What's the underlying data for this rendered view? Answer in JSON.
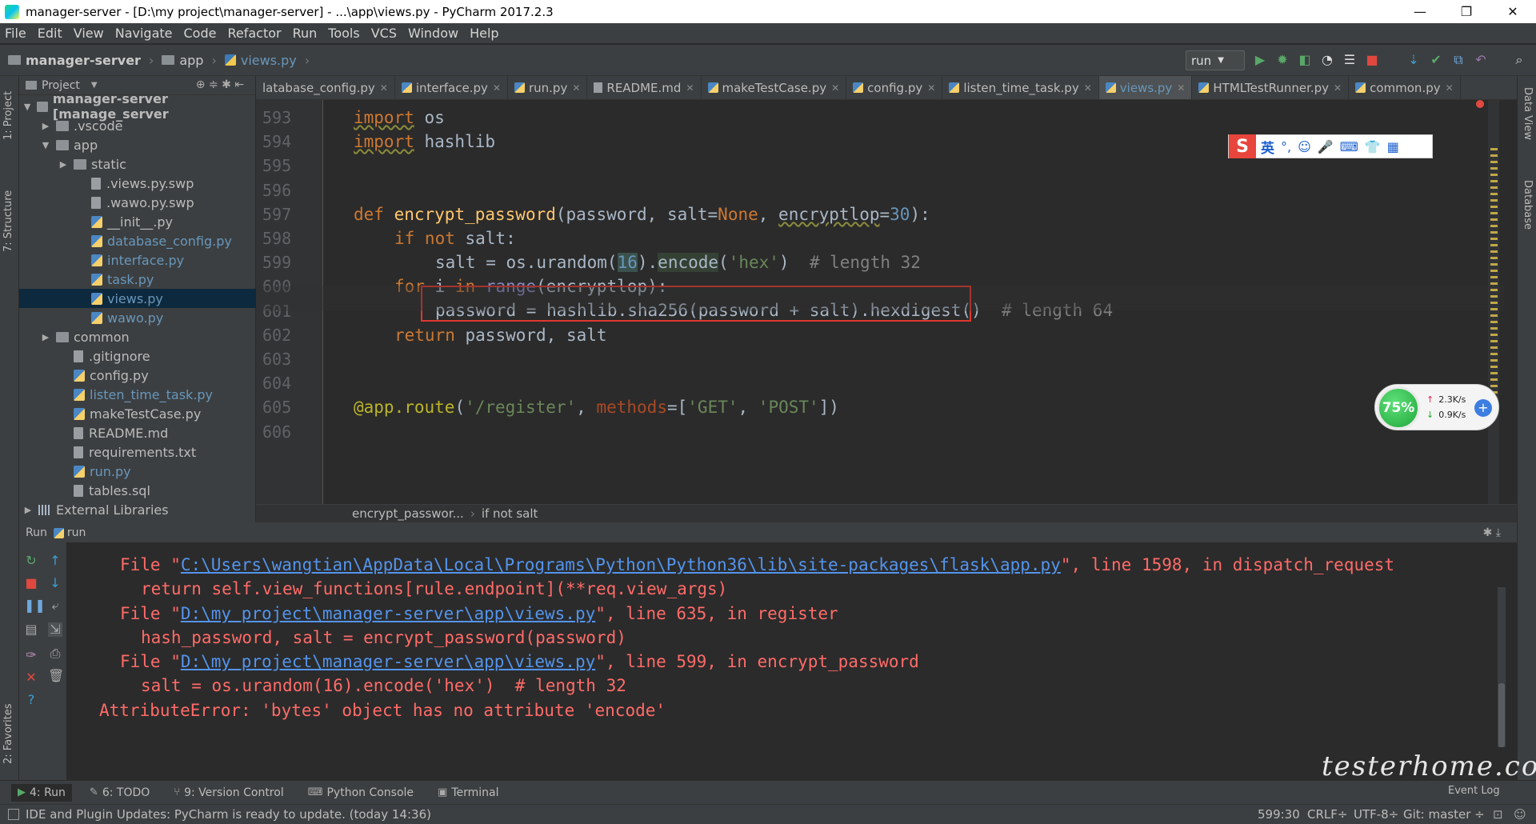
{
  "window": {
    "title": "manager-server - [D:\\my project\\manager-server] - ...\\app\\views.py - PyCharm 2017.2.3",
    "buttons": [
      "—",
      "❐",
      "✕"
    ]
  },
  "menu": [
    "File",
    "Edit",
    "View",
    "Navigate",
    "Code",
    "Refactor",
    "Run",
    "Tools",
    "VCS",
    "Window",
    "Help"
  ],
  "nav": {
    "crumbs": [
      "manager-server",
      "app",
      "views.py"
    ],
    "run_config": "run"
  },
  "left_stripe": {
    "project_label": "1: Project",
    "structure_label": "7: Structure",
    "favorites_label": "2: Favorites"
  },
  "right_stripe": {
    "dataview_label": "Data View",
    "database_label": "Database"
  },
  "project_panel": {
    "header": "Project",
    "items": [
      {
        "label": "manager-server [manage_server",
        "indent": 0,
        "toggle": "▼",
        "kind": "folder",
        "bold": true
      },
      {
        "label": ".vscode",
        "indent": 1,
        "toggle": "▶",
        "kind": "folder"
      },
      {
        "label": "app",
        "indent": 1,
        "toggle": "▼",
        "kind": "folder"
      },
      {
        "label": "static",
        "indent": 2,
        "toggle": "▶",
        "kind": "folder"
      },
      {
        "label": ".views.py.swp",
        "indent": 3,
        "toggle": "",
        "kind": "file"
      },
      {
        "label": ".wawo.py.swp",
        "indent": 3,
        "toggle": "",
        "kind": "file"
      },
      {
        "label": "__init__.py",
        "indent": 3,
        "toggle": "",
        "kind": "py"
      },
      {
        "label": "database_config.py",
        "indent": 3,
        "toggle": "",
        "kind": "py",
        "blue": true
      },
      {
        "label": "interface.py",
        "indent": 3,
        "toggle": "",
        "kind": "py",
        "blue": true
      },
      {
        "label": "task.py",
        "indent": 3,
        "toggle": "",
        "kind": "py",
        "blue": true
      },
      {
        "label": "views.py",
        "indent": 3,
        "toggle": "",
        "kind": "py",
        "blue": true,
        "selected": true
      },
      {
        "label": "wawo.py",
        "indent": 3,
        "toggle": "",
        "kind": "py",
        "blue": true
      },
      {
        "label": "common",
        "indent": 1,
        "toggle": "▶",
        "kind": "folder"
      },
      {
        "label": ".gitignore",
        "indent": 2,
        "toggle": "",
        "kind": "file"
      },
      {
        "label": "config.py",
        "indent": 2,
        "toggle": "",
        "kind": "py"
      },
      {
        "label": "listen_time_task.py",
        "indent": 2,
        "toggle": "",
        "kind": "py",
        "blue": true
      },
      {
        "label": "makeTestCase.py",
        "indent": 2,
        "toggle": "",
        "kind": "py"
      },
      {
        "label": "README.md",
        "indent": 2,
        "toggle": "",
        "kind": "file"
      },
      {
        "label": "requirements.txt",
        "indent": 2,
        "toggle": "",
        "kind": "file"
      },
      {
        "label": "run.py",
        "indent": 2,
        "toggle": "",
        "kind": "py",
        "blue": true
      },
      {
        "label": "tables.sql",
        "indent": 2,
        "toggle": "",
        "kind": "file"
      },
      {
        "label": "External Libraries",
        "indent": 0,
        "toggle": "▶",
        "kind": "lib"
      }
    ]
  },
  "tabs": [
    {
      "label": "latabase_config.py",
      "kind": "none"
    },
    {
      "label": "interface.py",
      "kind": "py"
    },
    {
      "label": "run.py",
      "kind": "py"
    },
    {
      "label": "README.md",
      "kind": "md"
    },
    {
      "label": "makeTestCase.py",
      "kind": "py"
    },
    {
      "label": "config.py",
      "kind": "py"
    },
    {
      "label": "listen_time_task.py",
      "kind": "py"
    },
    {
      "label": "views.py",
      "kind": "py",
      "active": true
    },
    {
      "label": "HTMLTestRunner.py",
      "kind": "py"
    },
    {
      "label": "common.py",
      "kind": "py"
    }
  ],
  "editor": {
    "line_numbers": [
      "593",
      "594",
      "595",
      "596",
      "597",
      "598",
      "599",
      "600",
      "601",
      "602",
      "603",
      "604",
      "605",
      "606"
    ],
    "breadcrumb": [
      "encrypt_passwor...",
      "if not salt"
    ]
  },
  "code": {
    "l593_kw": "import",
    "l593_rest": " os",
    "l594_kw": "import",
    "l594_rest": " hashlib",
    "l597_def": "def ",
    "l597_fn": "encrypt_password",
    "l597_a": "(password, salt=",
    "l597_none": "None",
    "l597_b": ", ",
    "l597_enc": "encryptlop",
    "l597_c": "=",
    "l597_num": "30",
    "l597_d": "):",
    "l598_if": "if not",
    "l598_rest": " salt:",
    "l599_a": "salt = os.urandom(",
    "l599_num": "16",
    "l599_b": ").",
    "l599_enc": "encode",
    "l599_c": "(",
    "l599_str": "'hex'",
    "l599_d": ")  ",
    "l599_cmt": "# length 32",
    "l600_for": "for ",
    "l600_i": "i ",
    "l600_in": "in ",
    "l600_range": "range",
    "l600_rest": "(encryptlop):",
    "l601_a": "password = hashlib.sha256(password + salt).hexdigest()  ",
    "l601_cmt": "# length 64",
    "l602_ret": "return ",
    "l602_rest": "password, salt",
    "l605_deco": "@app.",
    "l605_route": "route",
    "l605_a": "(",
    "l605_str1": "'/register'",
    "l605_b": ", ",
    "l605_methods": "methods",
    "l605_c": "=[",
    "l605_str2": "'GET'",
    "l605_d": ", ",
    "l605_str3": "'POST'",
    "l605_e": "])"
  },
  "run": {
    "header_label": "Run",
    "config_label": "run",
    "output": {
      "l1_pre": "File \"",
      "l1_link": "C:\\Users\\wangtian\\AppData\\Local\\Programs\\Python\\Python36\\lib\\site-packages\\flask\\app.py",
      "l1_post": "\", line 1598, in dispatch_request",
      "l2": "return self.view_functions[rule.endpoint](**req.view_args)",
      "l3_pre": "File \"",
      "l3_link": "D:\\my project\\manager-server\\app\\views.py",
      "l3_post": "\", line 635, in register",
      "l4": "hash_password, salt = encrypt_password(password)",
      "l5_pre": "File \"",
      "l5_link": "D:\\my project\\manager-server\\app\\views.py",
      "l5_post": "\", line 599, in encrypt_password",
      "l6": "salt = os.urandom(16).encode('hex')  # length 32",
      "l7": "AttributeError: 'bytes' object has no attribute 'encode'"
    }
  },
  "bottom_tabs": [
    {
      "label": "4: Run",
      "icon": "▶",
      "active": true
    },
    {
      "label": "6: TODO",
      "icon": "✎"
    },
    {
      "label": "9: Version Control",
      "icon": "⑂"
    },
    {
      "label": "Python Console",
      "icon": "⌨"
    },
    {
      "label": "Terminal",
      "icon": "▣"
    }
  ],
  "event_log": "Event Log",
  "status": {
    "message": "IDE and Plugin Updates: PyCharm is ready to update. (today 14:36)",
    "position": "599:30",
    "line_sep": "CRLF÷",
    "encoding": "UTF-8÷",
    "git": "Git: master ÷"
  },
  "ime": {
    "logo": "S",
    "lang": "英",
    "icons": [
      "°,",
      "☺",
      "🎤",
      "⌨",
      "👕",
      "▦"
    ]
  },
  "net": {
    "percent": "75%",
    "up": "2.3K/s",
    "down": "0.9K/s"
  },
  "watermark": "testerhome.com",
  "colors": {
    "error_text": "#ff6b68",
    "link": "#5394ec",
    "highlight_box": "#e0372f",
    "keyword": "#cc7832"
  }
}
